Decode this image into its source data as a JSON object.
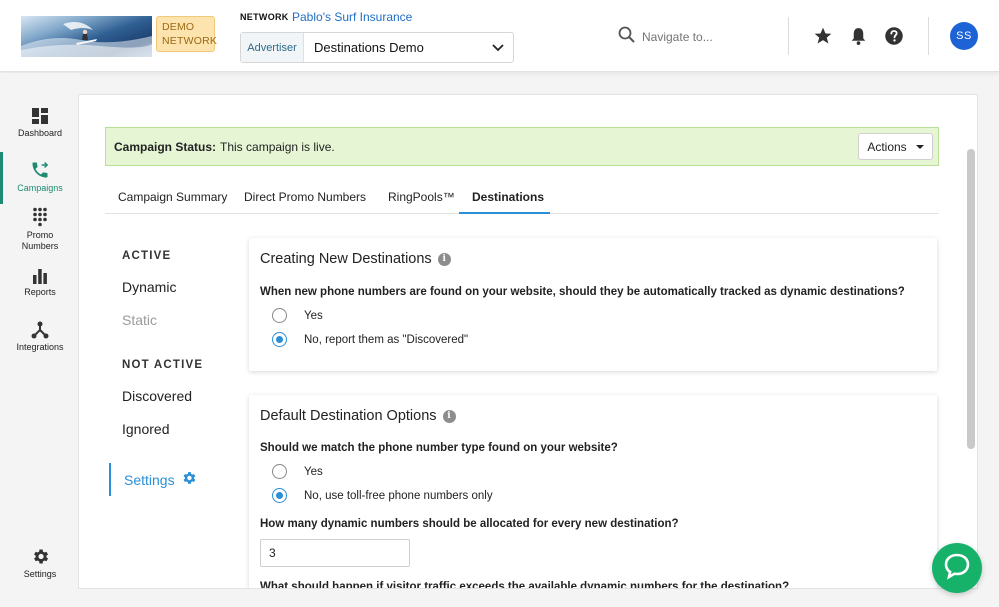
{
  "header": {
    "demo_badge": "DEMO\nNETWORK",
    "network_label": "NETWORK",
    "network_name": "Pablo's Surf Insurance",
    "advertiser_label": "Advertiser",
    "advertiser_value": "Destinations Demo",
    "search_placeholder": "Navigate to...",
    "avatar_initials": "SS"
  },
  "sidebar": {
    "items": [
      {
        "label": "Dashboard",
        "icon": "dashboard-icon"
      },
      {
        "label": "Campaigns",
        "icon": "phone-forward-icon"
      },
      {
        "label": "Promo\nNumbers",
        "icon": "dialpad-icon"
      },
      {
        "label": "Reports",
        "icon": "bar-chart-icon"
      },
      {
        "label": "Integrations",
        "icon": "integrations-icon"
      },
      {
        "label": "Settings",
        "icon": "gear-icon"
      }
    ]
  },
  "status": {
    "label": "Campaign Status:",
    "text": "This campaign is live.",
    "actions_label": "Actions"
  },
  "tabs": [
    {
      "label": "Campaign Summary"
    },
    {
      "label": "Direct Promo Numbers"
    },
    {
      "label": "RingPools™"
    },
    {
      "label": "Destinations"
    }
  ],
  "subnav": {
    "active_heading": "ACTIVE",
    "dynamic": "Dynamic",
    "static": "Static",
    "not_active_heading": "NOT ACTIVE",
    "discovered": "Discovered",
    "ignored": "Ignored",
    "settings": "Settings"
  },
  "panel1": {
    "title": "Creating New Destinations",
    "question": "When new phone numbers are found on your website, should they be automatically tracked as dynamic destinations?",
    "options": [
      "Yes",
      "No, report them as \"Discovered\""
    ],
    "selected_index": 1
  },
  "panel2": {
    "title": "Default Destination Options",
    "question1": "Should we match the phone number type found on your website?",
    "options": [
      "Yes",
      "No, use toll-free phone numbers only"
    ],
    "selected_index": 1,
    "question2": "How many dynamic numbers should be allocated for every new destination?",
    "allocated_value": "3",
    "question3": "What should happen if visitor traffic exceeds the available dynamic numbers for the destination?"
  },
  "colors": {
    "accent": "#2a8fd6",
    "active_nav": "#1e8a72",
    "status_bg": "#e6f6d5",
    "avatar": "#1e63d6",
    "chat": "#17b26a"
  }
}
